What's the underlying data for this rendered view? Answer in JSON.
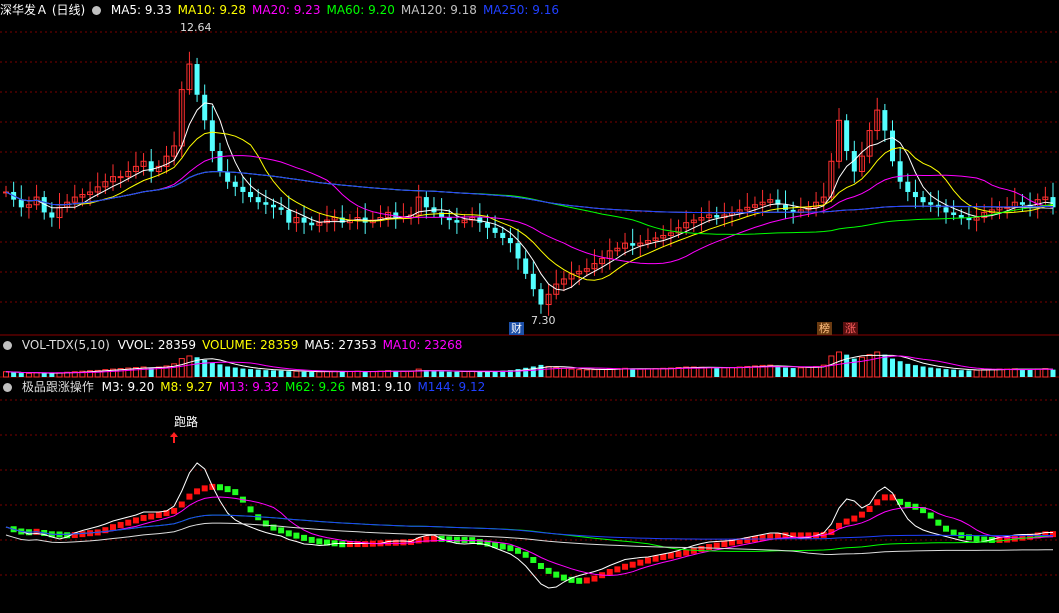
{
  "stock": {
    "name": "深华发Ａ (日线)"
  },
  "main": {
    "ma": [
      {
        "label": "MA5:",
        "value": "9.33",
        "color": "#ffffff"
      },
      {
        "label": "MA10:",
        "value": "9.28",
        "color": "#ffff00"
      },
      {
        "label": "MA20:",
        "value": "9.23",
        "color": "#ff00ff"
      },
      {
        "label": "MA60:",
        "value": "9.20",
        "color": "#00ff00"
      },
      {
        "label": "MA120:",
        "value": "9.18",
        "color": "#c0c0c0"
      },
      {
        "label": "MA250:",
        "value": "9.16",
        "color": "#2040ff"
      }
    ],
    "high_label": "12.64",
    "low_label": "7.30",
    "tags": {
      "cai": "财",
      "bang": "榜",
      "zhang": "涨"
    }
  },
  "volume": {
    "title": "VOL-TDX(5,10)",
    "items": [
      {
        "label": "VVOL:",
        "value": "28359",
        "color": "#ffffff"
      },
      {
        "label": "VOLUME:",
        "value": "28359",
        "color": "#ffff00"
      },
      {
        "label": "MA5:",
        "value": "27353",
        "color": "#ffffff"
      },
      {
        "label": "MA10:",
        "value": "23268",
        "color": "#ff00ff"
      }
    ]
  },
  "indicator": {
    "title": "极品跟涨操作",
    "items": [
      {
        "label": "M3:",
        "value": "9.20",
        "color": "#ffffff"
      },
      {
        "label": "M8:",
        "value": "9.27",
        "color": "#ffff00"
      },
      {
        "label": "M13:",
        "value": "9.32",
        "color": "#ff00ff"
      },
      {
        "label": "M62:",
        "value": "9.26",
        "color": "#00ff00"
      },
      {
        "label": "M81:",
        "value": "9.10",
        "color": "#ffffff"
      },
      {
        "label": "M144:",
        "value": "9.12",
        "color": "#2040ff"
      }
    ],
    "signal_label": "跑路"
  },
  "chart_data": {
    "type": "candlestick",
    "price_range": [
      7.0,
      13.0
    ],
    "closes": [
      9.6,
      9.45,
      9.3,
      9.35,
      9.5,
      9.2,
      9.1,
      9.3,
      9.4,
      9.5,
      9.55,
      9.6,
      9.7,
      9.8,
      9.9,
      9.9,
      10.0,
      10.1,
      10.2,
      10.0,
      10.1,
      10.3,
      10.5,
      11.6,
      12.1,
      11.5,
      11.0,
      10.4,
      10.0,
      9.8,
      9.7,
      9.6,
      9.5,
      9.4,
      9.35,
      9.3,
      9.25,
      9.0,
      9.1,
      9.0,
      8.95,
      9.0,
      9.05,
      9.1,
      9.0,
      9.05,
      9.1,
      9.0,
      9.05,
      9.1,
      9.2,
      9.1,
      9.1,
      9.15,
      9.5,
      9.3,
      9.2,
      9.1,
      9.05,
      9.0,
      9.05,
      9.1,
      9.0,
      8.9,
      8.8,
      8.7,
      8.6,
      8.3,
      8.0,
      7.7,
      7.4,
      7.6,
      7.8,
      7.9,
      8.0,
      8.05,
      8.1,
      8.2,
      8.3,
      8.45,
      8.5,
      8.6,
      8.55,
      8.6,
      8.65,
      8.7,
      8.75,
      8.8,
      8.9,
      9.0,
      9.05,
      9.1,
      9.15,
      9.1,
      9.15,
      9.2,
      9.25,
      9.3,
      9.35,
      9.4,
      9.45,
      9.35,
      9.25,
      9.2,
      9.25,
      9.3,
      9.4,
      9.5,
      10.2,
      11.0,
      10.4,
      10.0,
      10.3,
      10.8,
      11.2,
      10.8,
      10.2,
      9.8,
      9.6,
      9.5,
      9.4,
      9.35,
      9.3,
      9.2,
      9.15,
      9.1,
      9.05,
      9.1,
      9.2,
      9.25,
      9.3,
      9.3,
      9.4,
      9.35,
      9.3,
      9.45,
      9.5,
      9.3
    ],
    "volumes": [
      20,
      18,
      15,
      14,
      16,
      15,
      14,
      16,
      18,
      20,
      22,
      24,
      25,
      28,
      30,
      32,
      34,
      36,
      38,
      35,
      38,
      42,
      50,
      70,
      80,
      75,
      65,
      55,
      48,
      40,
      36,
      32,
      30,
      28,
      26,
      25,
      24,
      22,
      22,
      20,
      19,
      20,
      21,
      22,
      20,
      21,
      22,
      20,
      21,
      22,
      24,
      22,
      21,
      22,
      30,
      26,
      23,
      21,
      20,
      20,
      21,
      22,
      20,
      20,
      22,
      24,
      26,
      30,
      35,
      40,
      46,
      40,
      36,
      33,
      30,
      28,
      27,
      28,
      29,
      31,
      32,
      33,
      30,
      30,
      31,
      32,
      33,
      34,
      36,
      38,
      38,
      37,
      36,
      34,
      35,
      36,
      38,
      40,
      42,
      44,
      45,
      40,
      36,
      34,
      35,
      37,
      40,
      45,
      80,
      95,
      85,
      70,
      75,
      85,
      95,
      85,
      70,
      60,
      50,
      45,
      40,
      36,
      33,
      30,
      28,
      26,
      25,
      26,
      28,
      29,
      30,
      30,
      31,
      30,
      29,
      30,
      32,
      28
    ]
  }
}
